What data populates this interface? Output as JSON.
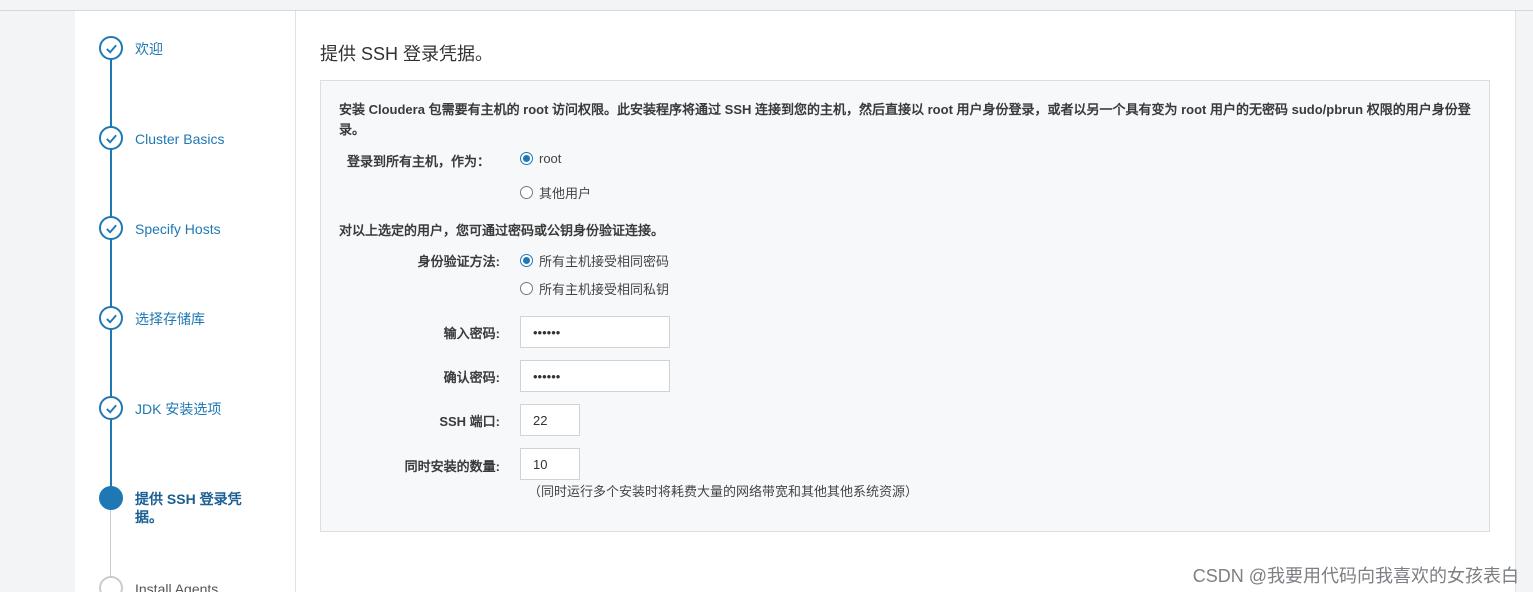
{
  "sidebar": {
    "steps": [
      {
        "label": "欢迎",
        "state": "done"
      },
      {
        "label": "Cluster Basics",
        "state": "done"
      },
      {
        "label": "Specify Hosts",
        "state": "done"
      },
      {
        "label": "选择存储库",
        "state": "done"
      },
      {
        "label": "JDK 安装选项",
        "state": "done"
      },
      {
        "label": "提供 SSH 登录凭据。",
        "state": "active"
      },
      {
        "label": "Install Agents",
        "state": "pending"
      }
    ]
  },
  "main": {
    "title": "提供 SSH 登录凭据。",
    "intro": "安装 Cloudera 包需要有主机的 root 访问权限。此安装程序将通过 SSH 连接到您的主机，然后直接以 root 用户身份登录，或者以另一个具有变为 root 用户的无密码 sudo/pbrun 权限的用户身份登录。",
    "login_label": "登录到所有主机，作为：",
    "login_options": [
      "root",
      "其他用户"
    ],
    "login_selected": "root",
    "auth_intro": "对以上选定的用户，您可通过密码或公钥身份验证连接。",
    "auth_label": "身份验证方法:",
    "auth_options": [
      "所有主机接受相同密码",
      "所有主机接受相同私钥"
    ],
    "auth_selected": "所有主机接受相同密码",
    "password_label": "输入密码:",
    "password_value": "••••••",
    "confirm_label": "确认密码:",
    "confirm_value": "••••••",
    "ssh_port_label": "SSH 端口:",
    "ssh_port_value": "22",
    "concurrency_label": "同时安装的数量:",
    "concurrency_value": "10",
    "concurrency_hint": "（同时运行多个安装时将耗费大量的网络带宽和其他其他系统资源）"
  },
  "watermark": "CSDN @我要用代码向我喜欢的女孩表白",
  "colors": {
    "accent": "#1f78b4",
    "panel_bg": "#f7f8fa"
  }
}
